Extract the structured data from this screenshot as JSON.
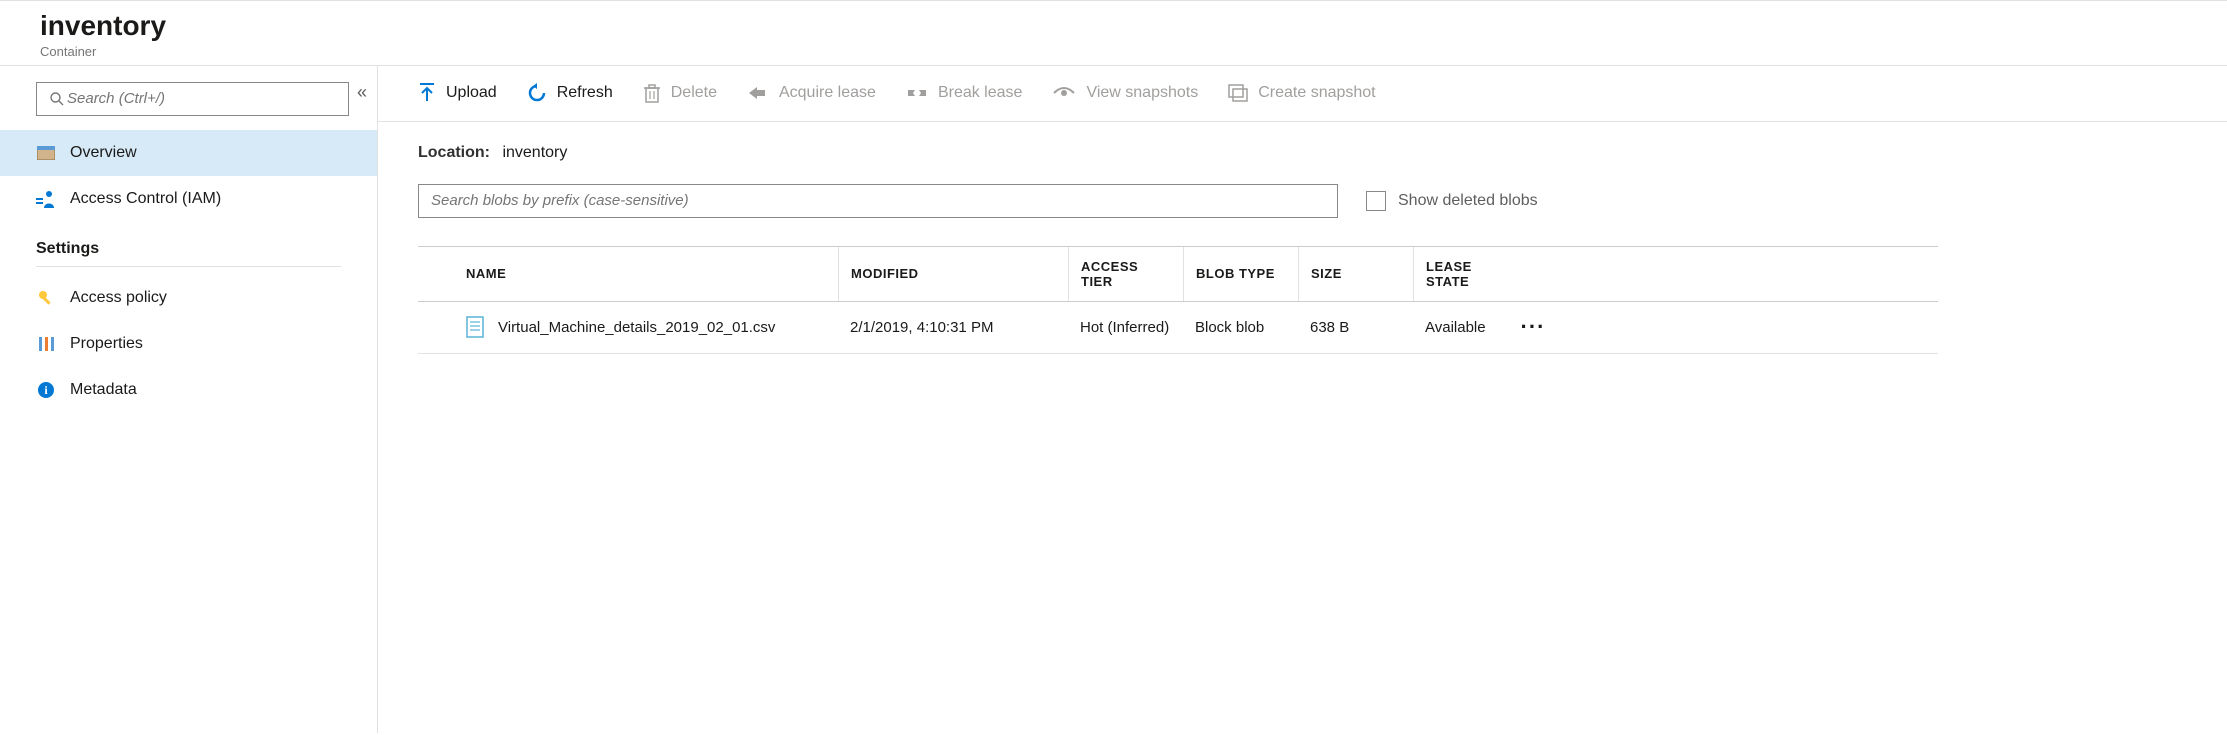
{
  "header": {
    "title": "inventory",
    "subtitle": "Container"
  },
  "sidebar": {
    "search_placeholder": "Search (Ctrl+/)",
    "items": [
      {
        "label": "Overview",
        "active": true
      },
      {
        "label": "Access Control (IAM)",
        "active": false
      }
    ],
    "settings_header": "Settings",
    "settings_items": [
      {
        "label": "Access policy"
      },
      {
        "label": "Properties"
      },
      {
        "label": "Metadata"
      }
    ]
  },
  "toolbar": {
    "upload": "Upload",
    "refresh": "Refresh",
    "delete": "Delete",
    "acquire_lease": "Acquire lease",
    "break_lease": "Break lease",
    "view_snapshots": "View snapshots",
    "create_snapshot": "Create snapshot"
  },
  "location": {
    "label": "Location:",
    "value": "inventory"
  },
  "filter": {
    "prefix_placeholder": "Search blobs by prefix (case-sensitive)",
    "show_deleted_label": "Show deleted blobs"
  },
  "table": {
    "headers": {
      "name": "NAME",
      "modified": "MODIFIED",
      "access_tier": "ACCESS TIER",
      "blob_type": "BLOB TYPE",
      "size": "SIZE",
      "lease_state": "LEASE STATE"
    },
    "rows": [
      {
        "name": "Virtual_Machine_details_2019_02_01.csv",
        "modified": "2/1/2019, 4:10:31 PM",
        "access_tier": "Hot (Inferred)",
        "blob_type": "Block blob",
        "size": "638 B",
        "lease_state": "Available"
      }
    ]
  }
}
